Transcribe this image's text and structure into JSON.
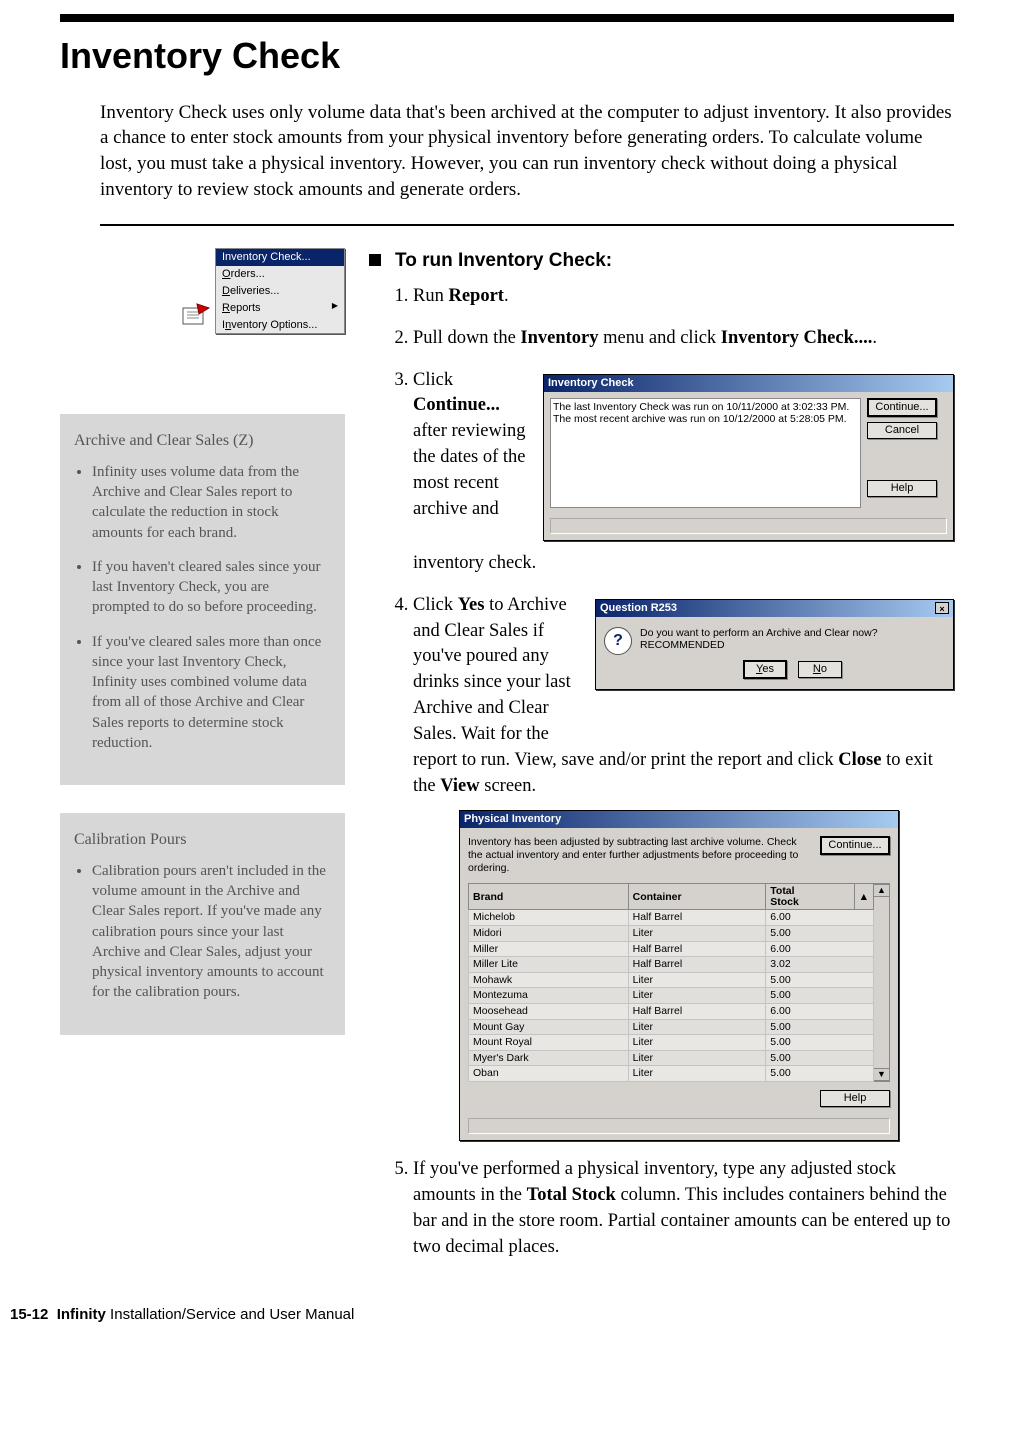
{
  "title": "Inventory Check",
  "intro": "Inventory Check uses only volume data that's been archived at the computer to adjust inventory. It also provides a chance to enter stock amounts from your physical inventory before generating orders. To calculate volume lost, you must take a physical inventory. However, you can run inventory check without doing a physical inventory to review stock amounts and generate orders.",
  "menu": {
    "items": [
      "Inventory Check...",
      "Orders...",
      "Deliveries...",
      "Reports",
      "Inventory Options..."
    ]
  },
  "sidebar1": {
    "title": "Archive and Clear Sales (Z)",
    "items": [
      "Infinity uses volume data from the Archive and Clear Sales report to calculate the reduction in stock amounts for each brand.",
      "If you haven't cleared sales since your last Inventory Check, you are prompted to do so before proceeding.",
      "If you've cleared sales more than once since your last Inventory Check, Infinity uses combined volume data from all of those Archive and Clear Sales reports to determine stock reduction."
    ]
  },
  "sidebar2": {
    "title": "Calibration Pours",
    "items": [
      "Calibration pours aren't included in the volume amount in the Archive and Clear Sales report. If you've made any calibration pours since your last Archive and Clear Sales, adjust your physical inventory amounts to account for the calibration pours."
    ]
  },
  "procedure": {
    "heading": "To run Inventory Check:",
    "step1_pre": "Run ",
    "step1_b": "Report",
    "step1_post": ".",
    "step2_pre": "Pull down the ",
    "step2_b1": "Inventory",
    "step2_mid": " menu and click ",
    "step2_b2": "Inventory Check....",
    "step2_post": ".",
    "step3_pre": "Click ",
    "step3_b": "Continue...",
    "step3_post1": " after reviewing the dates of the most recent archive and",
    "step3_post2": "inventory check.",
    "step4_pre": "Click ",
    "step4_b1": "Yes",
    "step4_mid1": " to Archive and Clear Sales if you've poured any drinks since your last Archive and Clear Sales. Wait for the",
    "step4_mid2": "report to run. View, save and/or print the report and click ",
    "step4_b2": "Close",
    "step4_mid3": " to exit the ",
    "step4_b3": "View",
    "step4_post": " screen.",
    "step5_pre": "If you've performed a physical inventory, type any adjusted stock amounts in the ",
    "step5_b": "Total Stock",
    "step5_post": " column. This includes containers behind the bar and in the store room. Partial container amounts can be entered up to two decimal places."
  },
  "ic_dialog": {
    "title": "Inventory Check",
    "line1": "The last Inventory Check was run on 10/11/2000 at 3:02:33 PM.",
    "line2": "The most recent archive was run on 10/12/2000 at 5:28:05 PM.",
    "btn_continue": "Continue...",
    "btn_cancel": "Cancel",
    "btn_help": "Help"
  },
  "q_dialog": {
    "title": "Question R253",
    "msg": "Do you want to perform an Archive and Clear now? RECOMMENDED",
    "yes": "Yes",
    "no": "No"
  },
  "pi_dialog": {
    "title": "Physical Inventory",
    "instr": "Inventory has been adjusted by subtracting last archive volume. Check the actual inventory and enter further adjustments before proceeding to ordering.",
    "headers": {
      "brand": "Brand",
      "container": "Container",
      "total": "Total Stock"
    },
    "rows": [
      {
        "brand": "Michelob",
        "container": "Half Barrel",
        "total": "6.00"
      },
      {
        "brand": "Midori",
        "container": "Liter",
        "total": "5.00"
      },
      {
        "brand": "Miller",
        "container": "Half Barrel",
        "total": "6.00"
      },
      {
        "brand": "Miller Lite",
        "container": "Half Barrel",
        "total": "3.02"
      },
      {
        "brand": "Mohawk",
        "container": "Liter",
        "total": "5.00"
      },
      {
        "brand": "Montezuma",
        "container": "Liter",
        "total": "5.00"
      },
      {
        "brand": "Moosehead",
        "container": "Half Barrel",
        "total": "6.00"
      },
      {
        "brand": "Mount Gay",
        "container": "Liter",
        "total": "5.00"
      },
      {
        "brand": "Mount Royal",
        "container": "Liter",
        "total": "5.00"
      },
      {
        "brand": "Myer's Dark",
        "container": "Liter",
        "total": "5.00"
      },
      {
        "brand": "Oban",
        "container": "Liter",
        "total": "5.00"
      }
    ],
    "btn_continue": "Continue...",
    "btn_help": "Help"
  },
  "footer": {
    "page": "15-12",
    "b": "Infinity",
    "rest": " Installation/Service and User Manual"
  }
}
